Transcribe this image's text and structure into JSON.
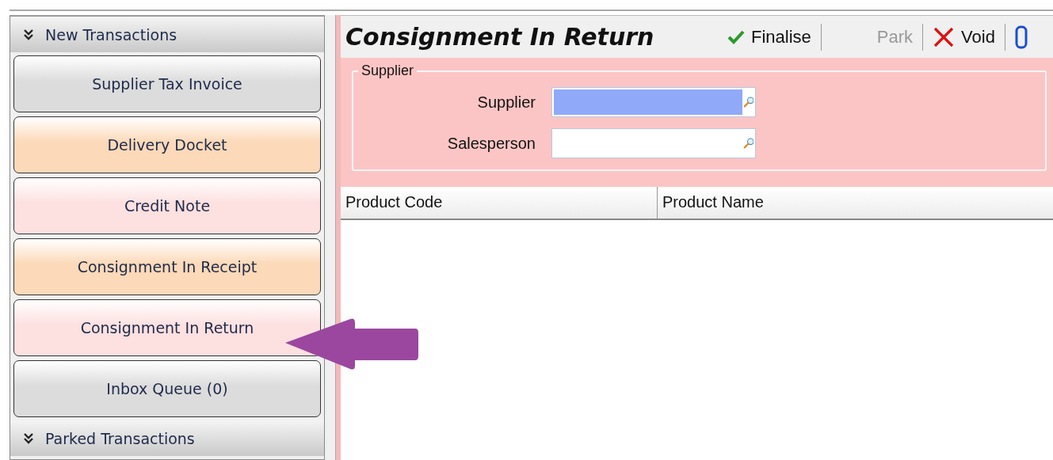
{
  "sidebar": {
    "header": "New Transactions",
    "items": [
      {
        "label": "Supplier Tax Invoice",
        "color": "#dcdcdc"
      },
      {
        "label": "Delivery Docket",
        "color": "#fcd9b8"
      },
      {
        "label": "Credit Note",
        "color": "#fde0e0"
      },
      {
        "label": "Consignment In Receipt",
        "color": "#fcd9b8"
      },
      {
        "label": "Consignment In Return",
        "color": "#fde0e0"
      },
      {
        "label": "Inbox Queue (0)",
        "color": "#dcdcdc"
      }
    ],
    "footer_header": "Parked Transactions"
  },
  "form": {
    "title": "Consignment In Return",
    "toolbar": [
      {
        "kind": "check",
        "label": "Finalise",
        "disabled": false
      },
      {
        "kind": "none",
        "label": "Park",
        "disabled": true
      },
      {
        "kind": "cross",
        "label": "Void",
        "disabled": false
      },
      {
        "kind": "clip",
        "disabled": false
      }
    ],
    "group": {
      "legend": "Supplier",
      "fields": [
        {
          "label": "Supplier",
          "focused": true
        },
        {
          "label": "Salesperson",
          "focused": false
        }
      ]
    },
    "table": {
      "columns": [
        "Product Code",
        "Product Name"
      ]
    }
  }
}
